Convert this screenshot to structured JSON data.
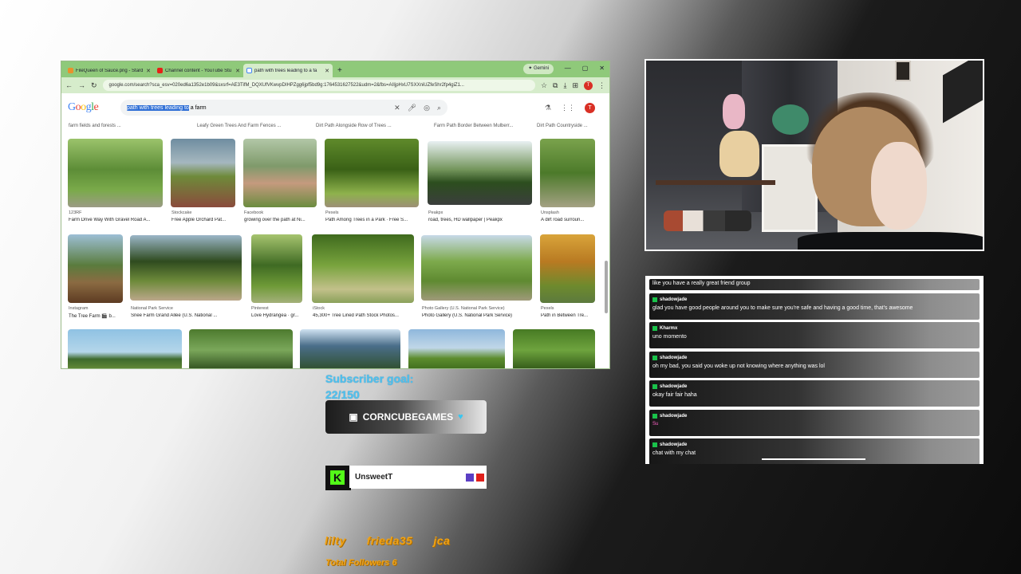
{
  "browser": {
    "tabs": [
      {
        "label": "FileQueen of Sauce.png - Stard",
        "fav": "#e8912d",
        "active": false
      },
      {
        "label": "Channel content - YouTube Stu",
        "fav": "#e62117",
        "active": false
      },
      {
        "label": "path with trees leading to a fa",
        "fav": "#4285f4",
        "active": true
      }
    ],
    "new_tab": "+",
    "gemini_label": "Gemini",
    "url": "google.com/search?sca_esv=020ed6a1352e1b09&sxsrf=AE3TifM_DQXUfVKwvpDIHPZgg6jpf5bd9g:1764531627522&udm=2&fbs=AIIjpHxU7SXXniUZfeShr2fp4giZ1...",
    "avatar_letter": "T",
    "search_query_selected": "path with trees leading to",
    "search_query_rest": " a farm",
    "logo_letters": [
      "G",
      "o",
      "o",
      "g",
      "l",
      "e"
    ],
    "top_captions": [
      "farm fields and forests ...",
      "Leafy Green Trees And Farm Fences ...",
      "Dirt Path Alongside Row of Trees ...",
      "Farm Path Border Between Mulberr...",
      "Dirt Path Countryside ..."
    ],
    "row1": [
      {
        "source": "123RF",
        "title": "Farm Drive Way With Gravel Road A..."
      },
      {
        "source": "Stockcake",
        "title": "Free Apple Orchard Pat..."
      },
      {
        "source": "Facebook",
        "title": "growing over the path at Ni..."
      },
      {
        "source": "Pexels",
        "title": "Path Among Trees in a Park · Free S..."
      },
      {
        "source": "Peakpx",
        "title": "road, trees, HD wallpaper | Peakpx"
      },
      {
        "source": "Unsplash",
        "title": "A dirt road surroun..."
      }
    ],
    "row2": [
      {
        "source": "Instagram",
        "title": "The Tree Farm 🎬 b..."
      },
      {
        "source": "National Park Service",
        "title": "Snee Farm Grand Allée (U.S. National ..."
      },
      {
        "source": "Pinterest",
        "title": "Love Hydrangea · gr..."
      },
      {
        "source": "iStock",
        "title": "45,300+ Tree Lined Path Stock Photos..."
      },
      {
        "source": "Photo Gallery (U.S. National Park Service)",
        "title": "Photo Gallery (U.S. National Park Service)"
      },
      {
        "source": "Pexels",
        "title": "Path in Between Tre..."
      }
    ]
  },
  "chat": {
    "partial_top": "like you have a really great friend group",
    "messages": [
      {
        "user": "shadowjade",
        "text": "glad you have good people around you to make sure you're safe and having a good time, that's awesome"
      },
      {
        "user": "Kharmx",
        "text": "uno momento"
      },
      {
        "user": "shadowjade",
        "text": "oh my bad, you said you woke up not knowing where anything was lol"
      },
      {
        "user": "shadowjade",
        "text": "okay fair fair haha"
      },
      {
        "user": "shadowjade",
        "text": "Su",
        "pink": true
      },
      {
        "user": "shadowjade",
        "text": "chat with my chat"
      }
    ]
  },
  "overlay": {
    "subscriber_goal_label": "Subscriber goal:",
    "subscriber_goal_value": "22/150",
    "twitch_name": "CORNCUBEGAMES",
    "kick_user": "UnsweetT",
    "kick_logo": "K",
    "followers": [
      "lilty",
      "frieda35",
      "jca"
    ],
    "total_followers": "Total Followers 6"
  },
  "colors": {
    "browser_chrome": "#8fc97a",
    "subscriber_text": "#4ec1ef",
    "followers_text": "#f0a215",
    "kick_green": "#53fc18"
  }
}
